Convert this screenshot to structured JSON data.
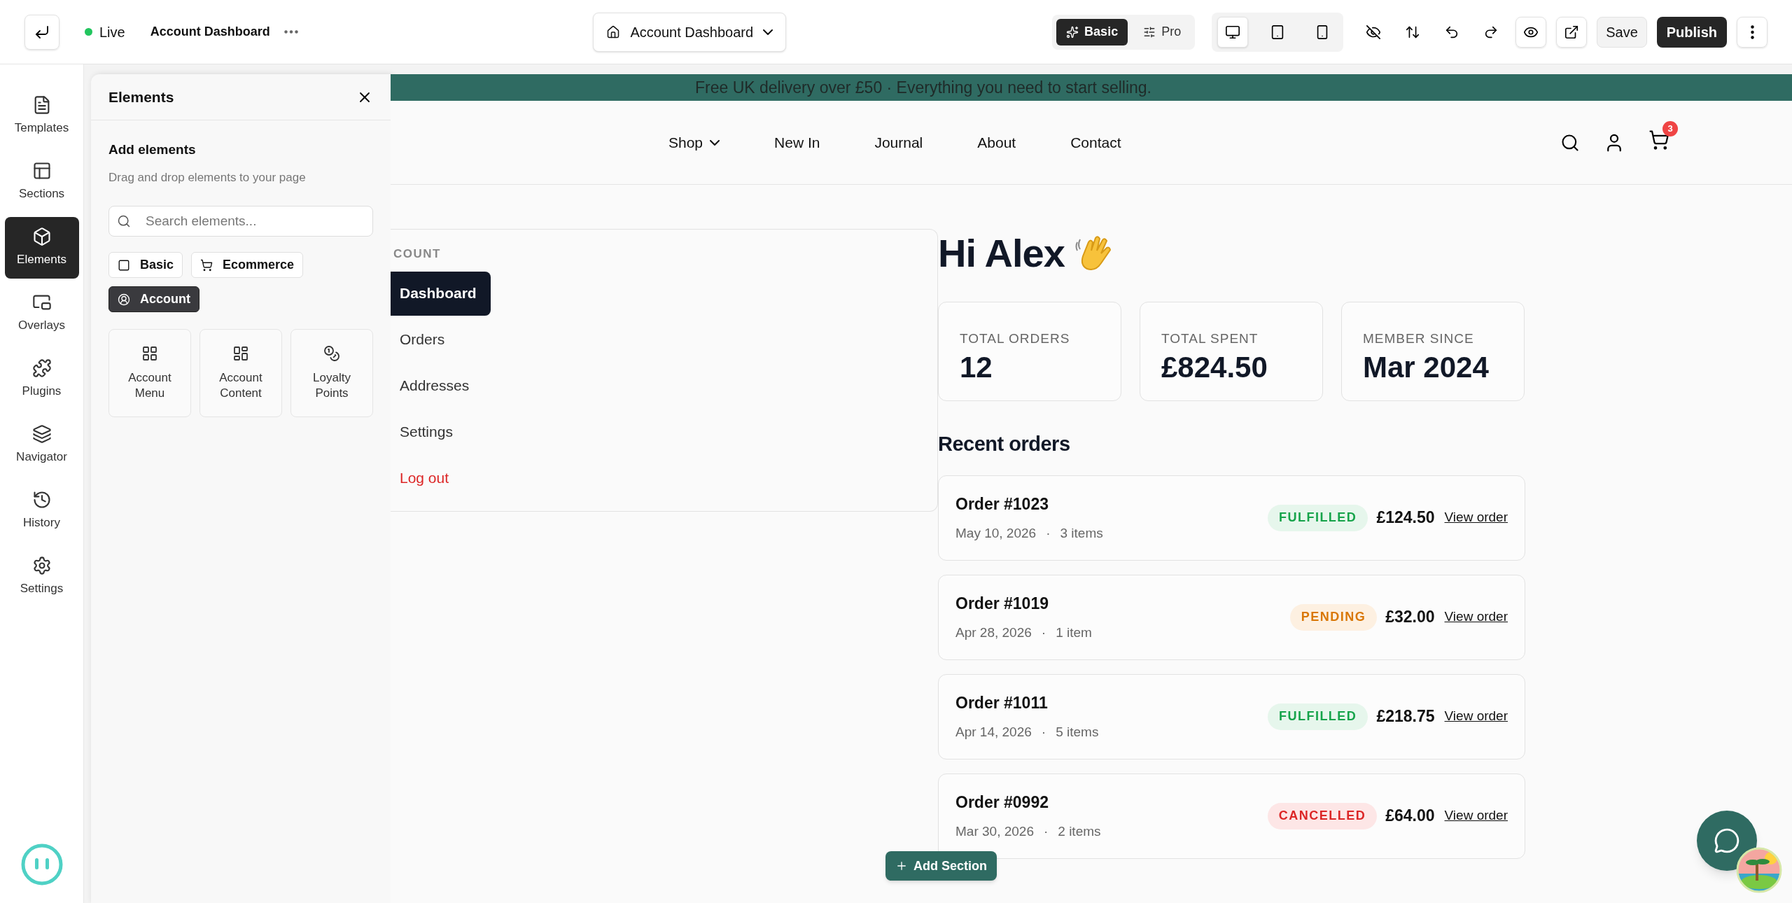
{
  "topbar": {
    "status": {
      "label": "Live",
      "live": true
    },
    "page_name": "Account Dashboard",
    "page_selector": "Account Dashboard",
    "modes": [
      {
        "label": "Basic",
        "kind": "sparkles",
        "selected": true
      },
      {
        "label": "Pro",
        "kind": "sliders",
        "selected": false
      }
    ],
    "devices": [
      {
        "kind": "desktop",
        "selected": true
      },
      {
        "kind": "tablet",
        "selected": false
      },
      {
        "kind": "phone",
        "selected": false
      }
    ],
    "save": "Save",
    "publish": "Publish"
  },
  "rail": {
    "items": [
      {
        "label": "Templates",
        "kind": "templates",
        "selected": false
      },
      {
        "label": "Sections",
        "kind": "sections",
        "selected": false
      },
      {
        "label": "Elements",
        "kind": "elements",
        "selected": true
      },
      {
        "label": "Overlays",
        "kind": "overlays",
        "selected": false
      },
      {
        "label": "Plugins",
        "kind": "plugins",
        "selected": false
      },
      {
        "label": "Navigator",
        "kind": "navigator",
        "selected": false
      },
      {
        "label": "History",
        "kind": "history",
        "selected": false
      },
      {
        "label": "Settings",
        "kind": "settings",
        "selected": false
      }
    ]
  },
  "panel": {
    "title": "Elements",
    "heading": "Add elements",
    "subtitle": "Drag and drop elements to your page",
    "search": {
      "placeholder": "Search elements..."
    },
    "categories": [
      {
        "label": "Basic",
        "kind": "basic",
        "selected": false
      },
      {
        "label": "Ecommerce",
        "kind": "ecommerce",
        "selected": false
      },
      {
        "label": "Account",
        "kind": "account",
        "selected": true
      }
    ],
    "elements": [
      {
        "label": "Account Menu",
        "kind": "menu"
      },
      {
        "label": "Account Content",
        "kind": "content"
      },
      {
        "label": "Loyalty Points",
        "kind": "points"
      }
    ]
  },
  "site": {
    "announcement": "Free UK delivery over £50 · Everything you need to start selling.",
    "nav": [
      {
        "label": "Shop",
        "has_menu": true
      },
      {
        "label": "New In",
        "has_menu": false
      },
      {
        "label": "Journal",
        "has_menu": false
      },
      {
        "label": "About",
        "has_menu": false
      },
      {
        "label": "Contact",
        "has_menu": false
      }
    ],
    "cart_count": "3",
    "account_menu": {
      "heading": "COUNT",
      "items": [
        {
          "label": "Dashboard",
          "kind": "link",
          "selected": true
        },
        {
          "label": "Orders",
          "kind": "link",
          "selected": false
        },
        {
          "label": "Addresses",
          "kind": "link",
          "selected": false
        },
        {
          "label": "Settings",
          "kind": "link",
          "selected": false
        },
        {
          "label": "Log out",
          "kind": "danger",
          "selected": false
        }
      ]
    },
    "greeting": "Hi Alex",
    "stats": [
      {
        "label": "TOTAL ORDERS",
        "value": "12"
      },
      {
        "label": "TOTAL SPENT",
        "value": "£824.50"
      },
      {
        "label": "MEMBER SINCE",
        "value": "Mar 2024"
      }
    ],
    "recent_heading": "Recent orders",
    "orders": [
      {
        "title": "Order #1023",
        "date": "May 10, 2026",
        "separator": "·",
        "items": "3 items",
        "status": "FULFILLED",
        "kind": "fulfilled",
        "amount": "£124.50",
        "link": "View order"
      },
      {
        "title": "Order #1019",
        "date": "Apr 28, 2026",
        "separator": "·",
        "items": "1 item",
        "status": "PENDING",
        "kind": "pending",
        "amount": "£32.00",
        "link": "View order"
      },
      {
        "title": "Order #1011",
        "date": "Apr 14, 2026",
        "separator": "·",
        "items": "5 items",
        "status": "FULFILLED",
        "kind": "fulfilled",
        "amount": "£218.75",
        "link": "View order"
      },
      {
        "title": "Order #0992",
        "date": "Mar 30, 2026",
        "separator": "·",
        "items": "2 items",
        "status": "CANCELLED",
        "kind": "cancelled",
        "amount": "£64.00",
        "link": "View order"
      }
    ]
  },
  "add_section": "Add Section"
}
